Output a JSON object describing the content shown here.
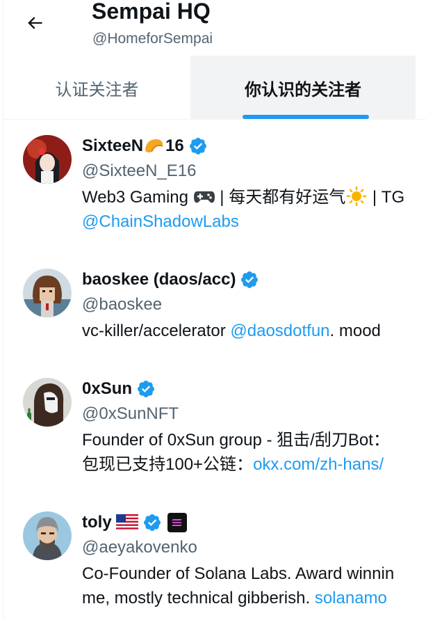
{
  "header": {
    "title": "Sempai HQ",
    "handle": "@HomeforSempai"
  },
  "tabs": [
    {
      "label": "认证关注者",
      "selected": false
    },
    {
      "label": "你认识的关注者",
      "selected": true
    }
  ],
  "colors": {
    "accent": "#1d9bf0",
    "secondary_text": "#536471",
    "verified_badge": "#1d9bf0"
  },
  "users": [
    {
      "name_part1": "SixteeN",
      "name_part2": "16",
      "name_emoji": "fortune-cookie-icon",
      "verified": true,
      "handle": "@SixteeN_E16",
      "bio_line1_a": "Web3 Gaming ",
      "bio_line1_b": " | 每天都有好运气",
      "bio_line1_c": " | TG",
      "bio_line2_link": "@ChainShadowLabs"
    },
    {
      "name": "baoskee (daos/acc)",
      "verified": true,
      "handle": "@baoskee",
      "bio_line1_a": "vc-killer/accelerator ",
      "bio_line1_link": "@daosdotfun",
      "bio_line1_b": ". mood"
    },
    {
      "name": "0xSun",
      "verified": true,
      "handle": "@0xSunNFT",
      "bio_line1": "Founder of 0xSun group - 狙击/刮刀Bot：",
      "bio_line2_a": "包现已支持100+公链：",
      "bio_line2_link": "okx.com/zh-hans/"
    },
    {
      "name": "toly",
      "verified": true,
      "flag": "us-flag-icon",
      "affiliate_badge": "solana-logo-icon",
      "handle": "@aeyakovenko",
      "bio_line1": "Co-Founder of Solana Labs. Award winnin",
      "bio_line2_a": "me, mostly technical gibberish. ",
      "bio_line2_link": "solanamo"
    }
  ]
}
